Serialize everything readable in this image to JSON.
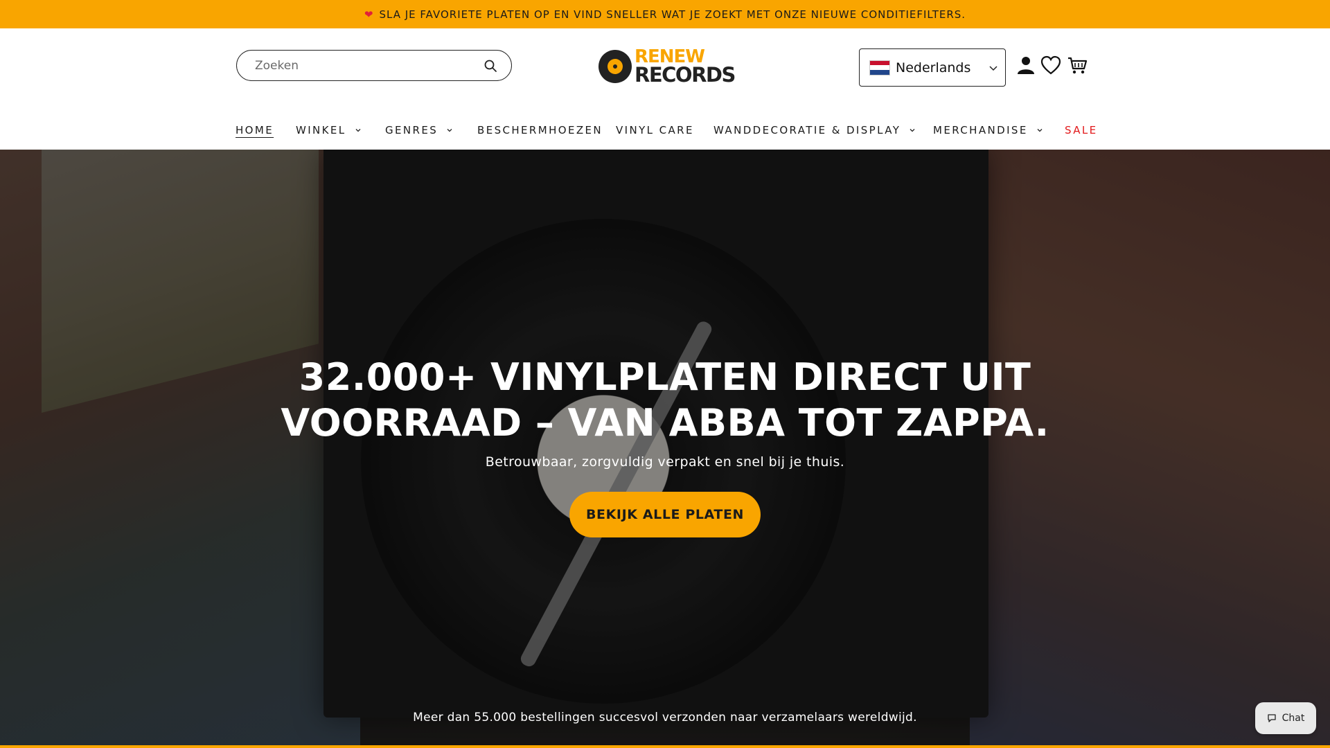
{
  "announcement": {
    "icon": "heart-icon",
    "text": "SLA JE FAVORIETE PLATEN OP EN VIND SNELLER WAT JE ZOEKT MET ONZE NIEUWE CONDITIEFILTERS."
  },
  "header": {
    "search": {
      "placeholder": "Zoeken"
    },
    "logo": {
      "line1": "RENEW",
      "line2": "RECORDS"
    },
    "language": {
      "selected": "Nederlands",
      "flag": "nl-flag"
    }
  },
  "nav": {
    "items": [
      {
        "label": "HOME"
      },
      {
        "label": "WINKEL"
      },
      {
        "label": "GENRES"
      },
      {
        "label": "BESCHERMHOEZEN"
      },
      {
        "label": "VINYL CARE"
      },
      {
        "label": "WANDDECORATIE & DISPLAY"
      },
      {
        "label": "MERCHANDISE"
      },
      {
        "label": "SALE"
      }
    ]
  },
  "hero": {
    "headline_1": "32.000+ VINYLPLATEN DIRECT UIT",
    "headline_2": "VOORRAAD – VAN ABBA TOT ZAPPA.",
    "subtitle": "Betrouwbaar, zorgvuldig verpakt en snel bij je thuis.",
    "cta": "BEKIJK ALLE PLATEN",
    "stat": "Meer dan 55.000 bestellingen succesvol verzonden naar verzamelaars wereldwijd."
  },
  "chat": {
    "label": "Chat"
  },
  "colors": {
    "accent": "#f9a500",
    "sale": "#e2191b",
    "text": "#121212"
  }
}
